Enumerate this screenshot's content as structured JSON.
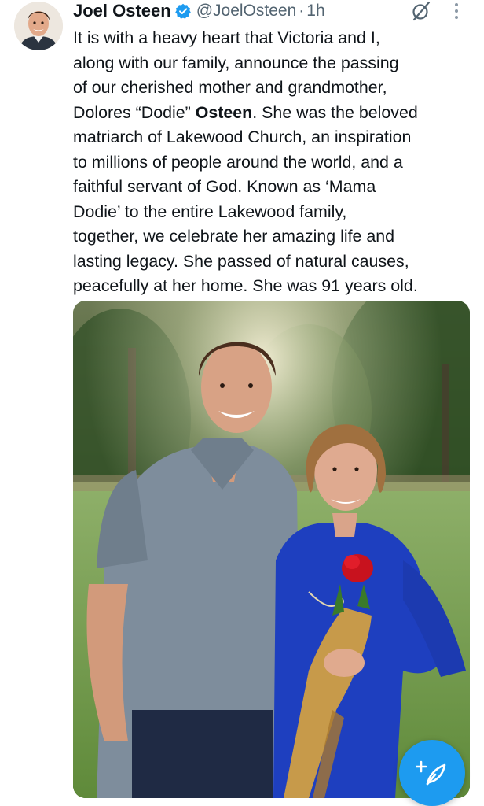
{
  "author": {
    "display_name": "Joel Osteen",
    "handle": "@JoelOsteen",
    "separator": "·",
    "time": "1h",
    "verified": true,
    "verified_color": "#1d9bf0"
  },
  "post": {
    "lines": [
      "It is with a heavy heart that Victoria and I,",
      "along with our family, announce the passing",
      "of our cherished mother and grandmother,"
    ],
    "line4_before": "Dolores “Dodie” ",
    "line4_bold": "Osteen",
    "line4_after": ". She was the beloved",
    "lines_rest": [
      "matriarch of Lakewood Church, an inspiration",
      "to millions of people around the world, and a",
      "faithful servant of God. Known as ‘Mama",
      "Dodie’ to the entire Lakewood family,",
      "together, we celebrate her amazing life and",
      "lasting legacy. She passed of natural causes,",
      "peacefully at her home. She was 91 years old."
    ]
  },
  "icons": {
    "avatar": "profile-photo",
    "verified": "verified-badge-icon",
    "grok": "grok-icon",
    "more": "more-vertical-icon",
    "compose": "compose-post-icon"
  },
  "colors": {
    "text": "#0f1419",
    "secondary_text": "#536471",
    "accent": "#1d9bf0"
  }
}
